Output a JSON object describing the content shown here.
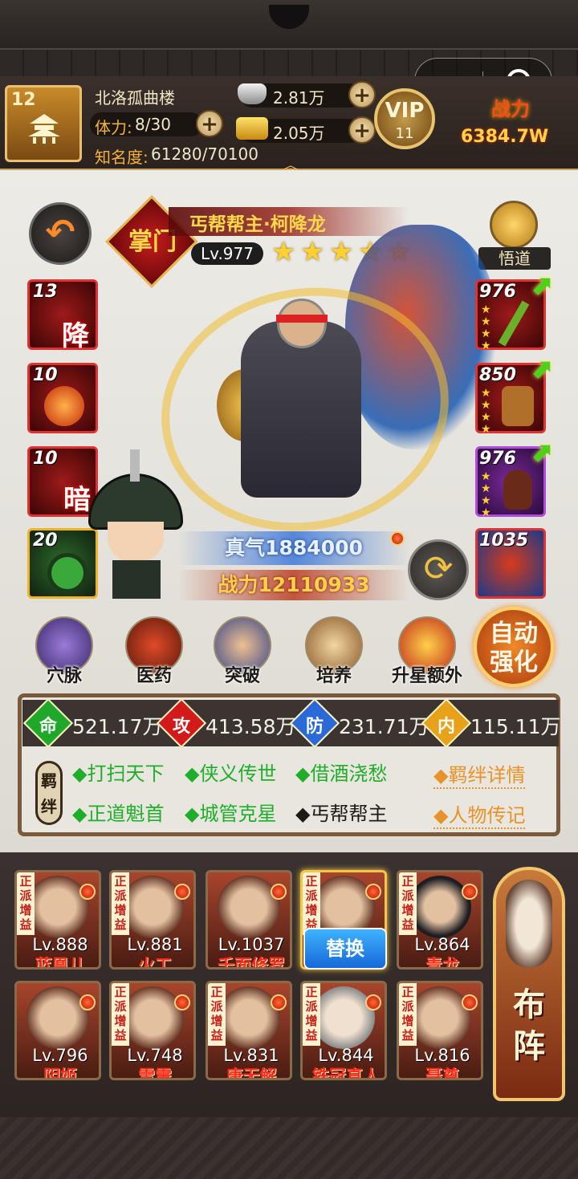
{
  "header": {
    "player_level": "12",
    "player_name": "北洛孤曲楼",
    "stamina_label": "体力:",
    "stamina_value": "8/30",
    "fame_label": "知名度:",
    "fame_value": "61280/70100",
    "silver": "2.81万",
    "gold": "2.05万",
    "vip_text": "VIP",
    "vip_level": "11",
    "combat_label": "战力",
    "combat_value": "6384.7W"
  },
  "hero": {
    "sect_badge": "掌门",
    "name": "丐帮帮主·柯降龙",
    "level": "Lv.977",
    "stars": 5,
    "zhenqi": "真气1884000",
    "power": "战力12110933",
    "wudao_label": "悟道"
  },
  "skills": [
    {
      "num": "13",
      "char": "降"
    },
    {
      "num": "10",
      "char": ""
    },
    {
      "num": "10",
      "char": "暗"
    },
    {
      "num": "20",
      "char": ""
    }
  ],
  "equipment": [
    {
      "num": "976"
    },
    {
      "num": "850"
    },
    {
      "num": "976"
    },
    {
      "num": "1035"
    }
  ],
  "functions": [
    {
      "label": "穴脉"
    },
    {
      "label": "医药"
    },
    {
      "label": "突破"
    },
    {
      "label": "培养"
    },
    {
      "label": "升星额外"
    }
  ],
  "auto_strengthen": "自动强化",
  "stats": [
    {
      "char": "命",
      "value": "521.17万",
      "color": "#1fa82a"
    },
    {
      "char": "攻",
      "value": "413.58万",
      "color": "#d21a1a"
    },
    {
      "char": "防",
      "value": "231.71万",
      "color": "#2a6ad8"
    },
    {
      "char": "内",
      "value": "115.11万",
      "color": "#e8a21a"
    }
  ],
  "bonds": {
    "label": "羁绊",
    "row1": [
      "◆打扫天下",
      "◆侠义传世",
      "◆借酒浇愁"
    ],
    "row2": [
      "◆正道魁首",
      "◆城管克星"
    ],
    "row2_inactive": "◆丐帮帮主",
    "link_details": "◆羁绊详情",
    "link_bio": "◆人物传记"
  },
  "team": [
    {
      "level": "Lv.888",
      "name": "蓝凰儿",
      "tag": "正派增益"
    },
    {
      "level": "Lv.881",
      "name": "火工",
      "tag": "正派增益"
    },
    {
      "level": "Lv.1037",
      "name": "千面修罗",
      "tag": ""
    },
    {
      "level": "",
      "name": "",
      "tag": "正派增益"
    },
    {
      "level": "Lv.864",
      "name": "青龙",
      "tag": "正派增益"
    },
    {
      "level": "Lv.796",
      "name": "阴姬",
      "tag": ""
    },
    {
      "level": "Lv.748",
      "name": "雷震",
      "tag": "正派增益"
    },
    {
      "level": "Lv.831",
      "name": "唐无解",
      "tag": "正派增益"
    },
    {
      "level": "Lv.844",
      "name": "铁冠真人",
      "tag": "正派增益"
    },
    {
      "level": "Lv.816",
      "name": "聂尊",
      "tag": "正派增益"
    }
  ],
  "swap_label": "替换",
  "formation_label": "布阵"
}
